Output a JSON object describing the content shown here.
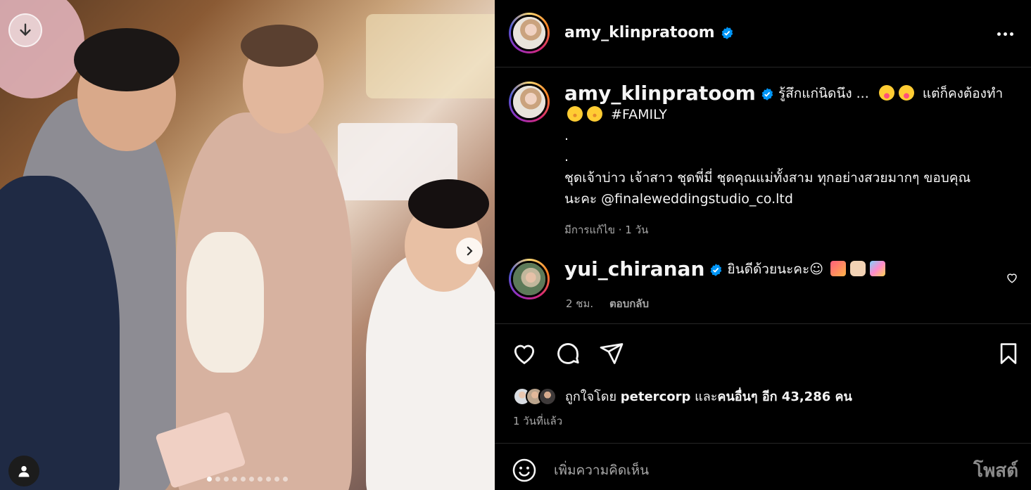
{
  "post": {
    "author": "amy_klinpratoom",
    "verified": true,
    "caption": {
      "line1_text": "รู้สึกแก่นิดนึง ...",
      "line1_tail": "แต่ก็คงต้องทำ",
      "hashtag": "#FAMILY",
      "dot1": ".",
      "dot2": ".",
      "line3": "ชุดเจ้าบ่าว เจ้าสาว ชุดพี่มี่ ชุดคุณแม่ทั้งสาม ทุกอย่างสวยมากๆ ขอบคุณ",
      "line4_prefix": "นะคะ",
      "mention": "@finaleweddingstudio_co.ltd"
    },
    "caption_meta": "มีการแก้ไข · 1 วัน"
  },
  "comment": {
    "username": "yui_chiranan",
    "verified": true,
    "text": "ยินดีด้วยนะคะ☺",
    "time": "2 ชม.",
    "reply_label": "ตอบกลับ"
  },
  "likes": {
    "prefix": "ถูกใจโดย",
    "user": "petercorp",
    "joiner": "และ",
    "others": "คนอื่นๆ อีก 43,286 คน"
  },
  "post_time": "1 วันที่แล้ว",
  "comment_input": {
    "placeholder": "เพิ่มความคิดเห็น",
    "post_label": "โพสต์"
  },
  "carousel": {
    "count": 10,
    "active_index": 0
  },
  "icons": {
    "download": "arrow-down-icon",
    "next": "chevron-right-icon",
    "user_tag": "user-icon",
    "more": "more-horizontal-icon",
    "like": "heart-icon",
    "comment": "comment-bubble-icon",
    "share": "paper-plane-icon",
    "save": "bookmark-icon",
    "emoji": "smiley-icon"
  },
  "colors": {
    "background": "#000000",
    "text": "#f5f5f5",
    "muted": "#a8a8a8",
    "verified": "#0095f6",
    "divider": "#262626"
  }
}
